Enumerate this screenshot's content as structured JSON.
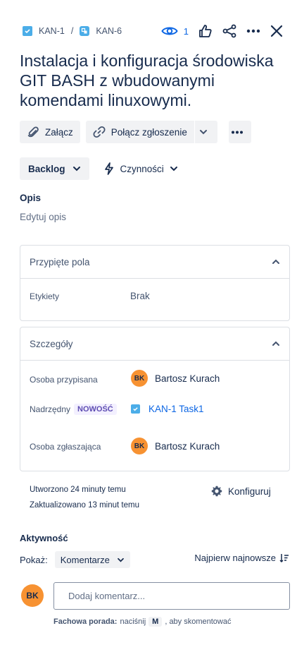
{
  "breadcrumb": {
    "parent_key": "KAN-1",
    "separator": "/",
    "current_key": "KAN-6"
  },
  "header": {
    "watchers_count": "1"
  },
  "issue": {
    "title": "Instalacja i konfiguracja środowiska GIT BASH z wbudowanymi komendami linuxowymi."
  },
  "toolbar": {
    "attach_label": "Załącz",
    "link_issue_label": "Połącz zgłoszenie"
  },
  "status": {
    "current": "Backlog",
    "actions_label": "Czynności"
  },
  "description": {
    "heading": "Opis",
    "edit_label": "Edytuj opis"
  },
  "pinned_panel": {
    "title": "Przypięte pola",
    "fields": [
      {
        "label": "Etykiety",
        "value": "Brak"
      }
    ]
  },
  "details_panel": {
    "title": "Szczegóły",
    "assignee_label": "Osoba przypisana",
    "assignee_initials": "BK",
    "assignee_name": "Bartosz Kurach",
    "parent_label": "Nadrzędny",
    "parent_badge": "NOWOŚĆ",
    "parent_value": "KAN-1 Task1",
    "reporter_label": "Osoba zgłaszająca",
    "reporter_initials": "BK",
    "reporter_name": "Bartosz Kurach"
  },
  "meta": {
    "created": "Utworzono 24 minuty temu",
    "updated": "Zaktualizowano 13 minut temu",
    "configure_label": "Konfiguruj"
  },
  "activity": {
    "heading": "Aktywność",
    "show_label": "Pokaż:",
    "filter_value": "Komentarze",
    "sort_label": "Najpierw najnowsze"
  },
  "comment": {
    "user_initials": "BK",
    "placeholder": "Dodaj komentarz...",
    "tip_strong": "Fachowa porada:",
    "tip_before": "naciśnij",
    "tip_key": "M",
    "tip_after": ", aby skomentować"
  },
  "colors": {
    "accent": "#0c66e4",
    "avatar": "#f79232",
    "task_icon": "#4bade8",
    "badge_text": "#5e4db2"
  }
}
